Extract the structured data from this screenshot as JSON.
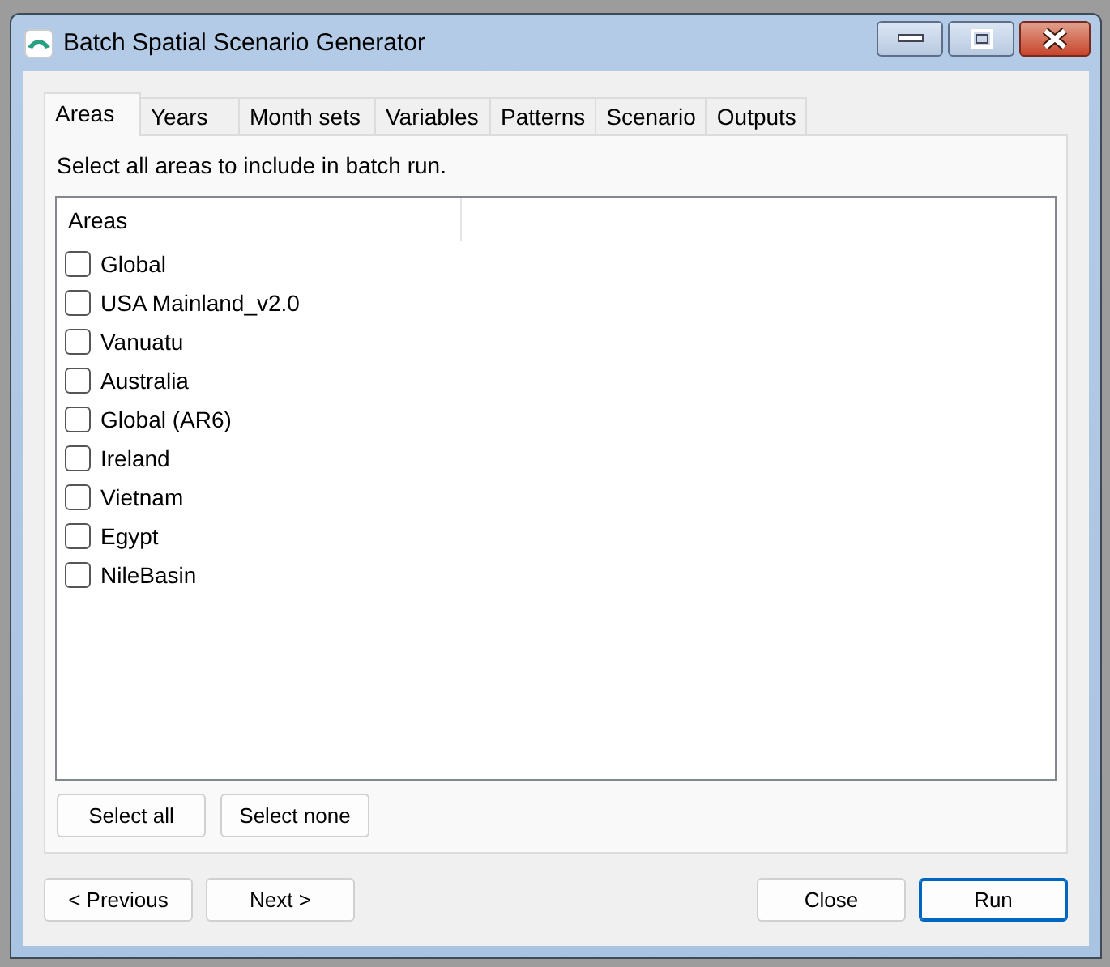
{
  "window": {
    "title": "Batch Spatial Scenario Generator"
  },
  "tabs": [
    {
      "label": "Areas",
      "selected": true
    },
    {
      "label": "Years",
      "selected": false
    },
    {
      "label": "Month sets",
      "selected": false
    },
    {
      "label": "Variables",
      "selected": false
    },
    {
      "label": "Patterns",
      "selected": false
    },
    {
      "label": "Scenario",
      "selected": false
    },
    {
      "label": "Outputs",
      "selected": false
    }
  ],
  "instruction": "Select all areas to include in batch run.",
  "area_list": {
    "column": "Areas",
    "items": [
      {
        "label": "Global",
        "checked": false
      },
      {
        "label": "USA Mainland_v2.0",
        "checked": false
      },
      {
        "label": "Vanuatu",
        "checked": false
      },
      {
        "label": "Australia",
        "checked": false
      },
      {
        "label": "Global (AR6)",
        "checked": false
      },
      {
        "label": "Ireland",
        "checked": false
      },
      {
        "label": "Vietnam",
        "checked": false
      },
      {
        "label": "Egypt",
        "checked": false
      },
      {
        "label": "NileBasin",
        "checked": false
      }
    ]
  },
  "selection_buttons": [
    {
      "label": "Select all",
      "default": false
    },
    {
      "label": "Select none",
      "default": false
    }
  ],
  "nav_buttons": [
    {
      "label": "< Previous",
      "default": false
    },
    {
      "label": "Next >",
      "default": false
    }
  ],
  "action_buttons": [
    {
      "label": "Close",
      "default": false
    },
    {
      "label": "Run",
      "default": true
    }
  ]
}
